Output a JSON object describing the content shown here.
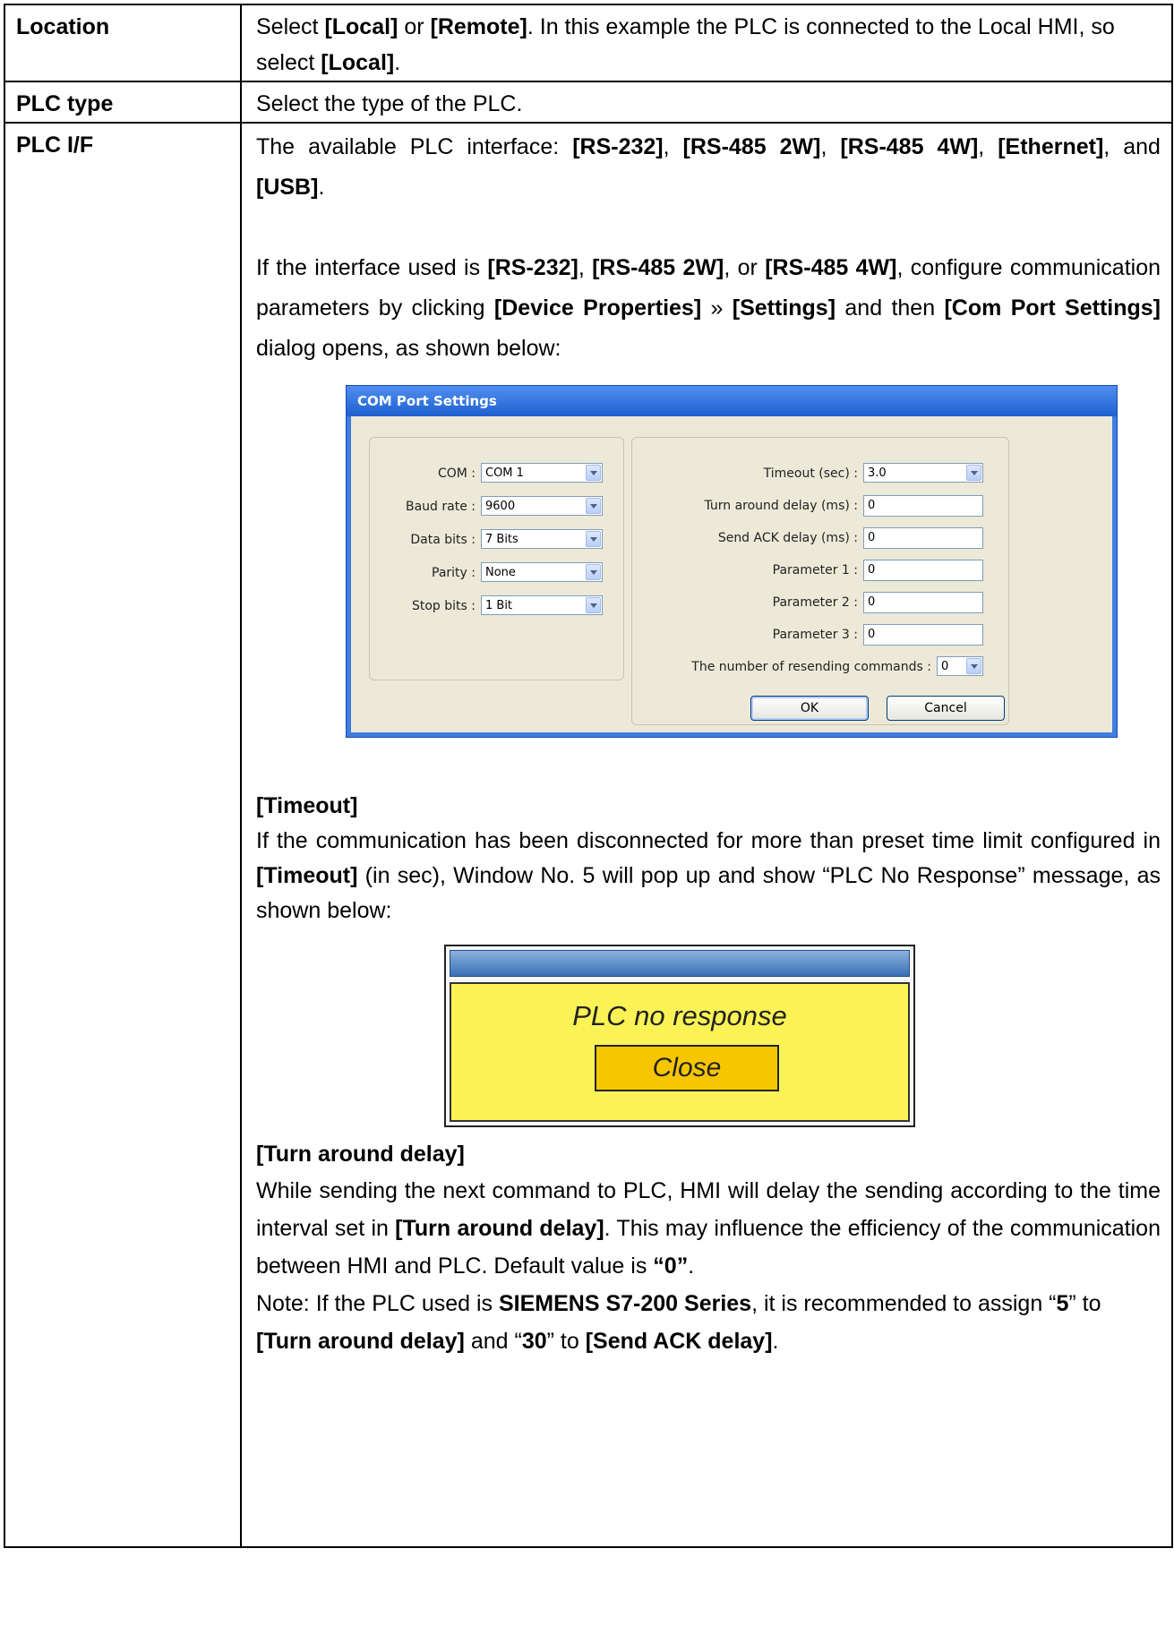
{
  "rows": {
    "location": {
      "header": "Location",
      "t1": "Select ",
      "b1": "[Local]",
      "t2": " or ",
      "b2": "[Remote]",
      "t3": ". In this example the PLC is connected to the Local HMI, so select ",
      "b3": "[Local]",
      "t4": "."
    },
    "plc_type": {
      "header": "PLC type",
      "text": "Select the type of the PLC."
    },
    "plc_if": {
      "header": "PLC I/F",
      "p1": {
        "t1": "The available PLC interface: ",
        "b1": "[RS-232]",
        "t2": ", ",
        "b2": "[RS-485 2W]",
        "t3": ", ",
        "b3": "[RS-485 4W]",
        "t4": ", ",
        "b4": "[Ethernet]",
        "t5": ", and ",
        "b5": "[USB]",
        "t6": "."
      },
      "p2": {
        "t1": "If the interface used is ",
        "b1": "[RS-232]",
        "t2": ", ",
        "b2": "[RS-485 2W]",
        "t3": ", or ",
        "b3": "[RS-485 4W]",
        "t4": ", configure communication parameters by clicking ",
        "b4": "[Device Properties]",
        "t5": " » ",
        "b5": "[Settings]",
        "t6": " and then ",
        "b6": "[Com Port Settings]",
        "t7": " dialog opens, as shown below:"
      },
      "timeout_heading": "[Timeout]",
      "p3": {
        "t1": "If the communication has been disconnected for more than preset time limit configured in ",
        "b1": "[Timeout]",
        "t2": " (in sec), Window No. 5 will pop up and show “PLC No Response” message, as shown below:"
      },
      "turn_heading": "[Turn around delay]",
      "p4": {
        "t1": "While sending the next command to PLC, HMI will delay the sending according to the time interval set in ",
        "b1": "[Turn around delay]",
        "t2": ". This may influence the efficiency of the communication between HMI and PLC. Default value is ",
        "b2": "“0”",
        "t3": "."
      },
      "p5": {
        "t1": "Note: If the PLC used is ",
        "b1": "SIEMENS S7-200 Series",
        "t2": ", it is recommended to assign “",
        "b2": "5",
        "t3": "” to ",
        "b3": "[Turn around delay]",
        "t4": " and “",
        "b4": "30",
        "t5": "” to ",
        "b5": "[Send ACK delay]",
        "t6": "."
      }
    }
  },
  "dialog": {
    "title": "COM Port Settings",
    "left": [
      {
        "label": "COM :",
        "value": "COM 1"
      },
      {
        "label": "Baud rate :",
        "value": "9600"
      },
      {
        "label": "Data bits :",
        "value": "7 Bits"
      },
      {
        "label": "Parity :",
        "value": "None"
      },
      {
        "label": "Stop bits :",
        "value": "1 Bit"
      }
    ],
    "timeout": {
      "label": "Timeout (sec) :",
      "value": "3.0"
    },
    "fields": [
      {
        "label": "Turn around delay (ms) :",
        "value": "0"
      },
      {
        "label": "Send ACK delay (ms) :",
        "value": "0"
      },
      {
        "label": "Parameter 1 :",
        "value": "0"
      },
      {
        "label": "Parameter 2 :",
        "value": "0"
      },
      {
        "label": "Parameter 3 :",
        "value": "0"
      }
    ],
    "resend": {
      "label": "The number of resending commands :",
      "value": "0"
    },
    "ok": "OK",
    "cancel": "Cancel"
  },
  "popup": {
    "message": "PLC no response",
    "button": "Close",
    "colors": {
      "background": "#fbf355",
      "button": "#f7c600",
      "titlebar": "#3a6fb5"
    }
  }
}
